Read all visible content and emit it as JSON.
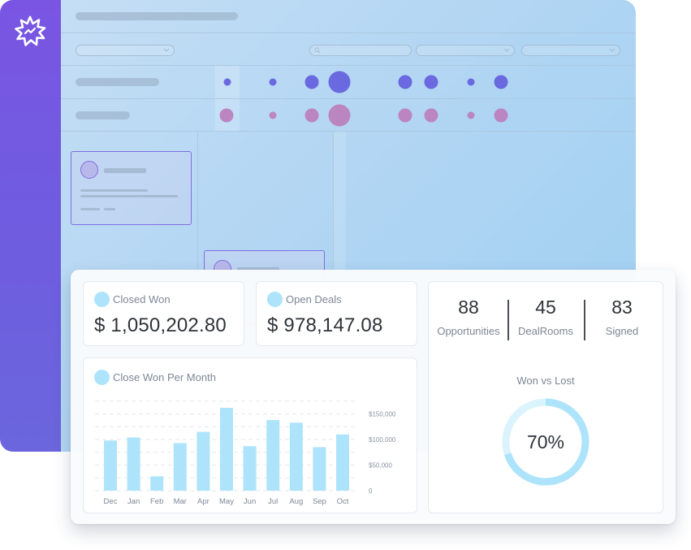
{
  "colors": {
    "sidebar": "#7a55e3",
    "accent_blue_dot": "#6a69df",
    "accent_pink_dot": "#bb85c2",
    "bar": "#aee4fb",
    "donut_fill": "#aee4fb",
    "donut_track": "#dbf3fd"
  },
  "logo": {
    "icon": "starburst-logo-icon"
  },
  "cards": {
    "closed_won": {
      "label": "Closed Won",
      "value": "$ 1,050,202.80"
    },
    "open_deals": {
      "label": "Open Deals",
      "value": "$ 978,147.08"
    }
  },
  "stats": [
    {
      "value": "88",
      "label": "Opportunities"
    },
    {
      "value": "45",
      "label": "DealRooms"
    },
    {
      "value": "83",
      "label": "Signed"
    }
  ],
  "won_vs_lost": {
    "title": "Won vs Lost",
    "percent_label": "70%",
    "fraction": 0.7
  },
  "chart_data": {
    "type": "bar",
    "title": "Close Won Per Month",
    "categories": [
      "Dec",
      "Jan",
      "Feb",
      "Mar",
      "Apr",
      "May",
      "Jun",
      "Jul",
      "Aug",
      "Sep",
      "Oct"
    ],
    "values": [
      98000,
      104000,
      28000,
      93000,
      115000,
      162000,
      87000,
      138000,
      133000,
      85000,
      110000
    ],
    "y_ticks": [
      {
        "value": 150000,
        "label": "$150,000"
      },
      {
        "value": 100000,
        "label": "$100,000"
      },
      {
        "value": 50000,
        "label": "$50,000"
      },
      {
        "value": 0,
        "label": "0"
      }
    ],
    "ylim": [
      0,
      180000
    ],
    "grid": true,
    "y_axis_side": "right"
  }
}
